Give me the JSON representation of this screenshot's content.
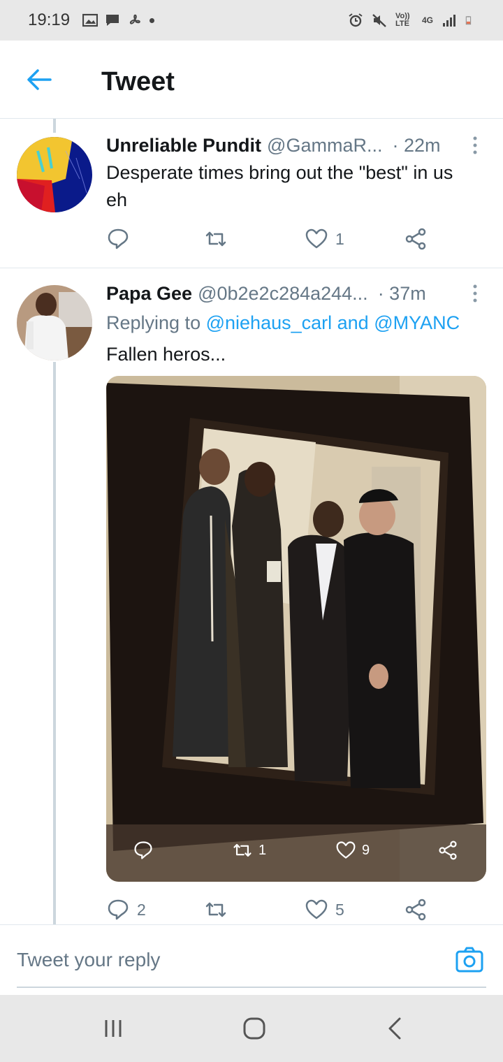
{
  "status_bar": {
    "time": "19:19",
    "icons_left": [
      "gallery-icon",
      "chat-icon",
      "fan-icon",
      "dot-icon"
    ],
    "icons_right": [
      "alarm-icon",
      "mute-icon",
      "volte-icon",
      "4g-icon",
      "signal-icon",
      "battery-icon"
    ],
    "volte_label": "Vo)) LTE",
    "network_label": "4G"
  },
  "header": {
    "title": "Tweet"
  },
  "tweets": [
    {
      "name": "Unreliable Pundit",
      "handle": "@GammaR...",
      "time": "· 22m",
      "text": "Desperate times bring out the \"best\" in us eh",
      "actions": {
        "reply_count": "",
        "retweet_count": "",
        "like_count": "1"
      }
    },
    {
      "name": "Papa Gee",
      "handle": "@0b2e2c284a244...",
      "time": "· 37m",
      "replying_prefix": "Replying to",
      "replying_mention_1": "@niehaus_carl",
      "replying_and": "and",
      "replying_mention_2": "@MYANC",
      "text": "Fallen heros...",
      "media_actions": {
        "retweet_count": "1",
        "like_count": "9"
      },
      "actions": {
        "reply_count": "2",
        "retweet_count": "",
        "like_count": "5"
      }
    }
  ],
  "reply_box": {
    "placeholder": "Tweet your reply"
  },
  "colors": {
    "accent": "#1da1f2",
    "text_primary": "#14171a",
    "text_secondary": "#657786",
    "divider": "#e1e8ed"
  }
}
